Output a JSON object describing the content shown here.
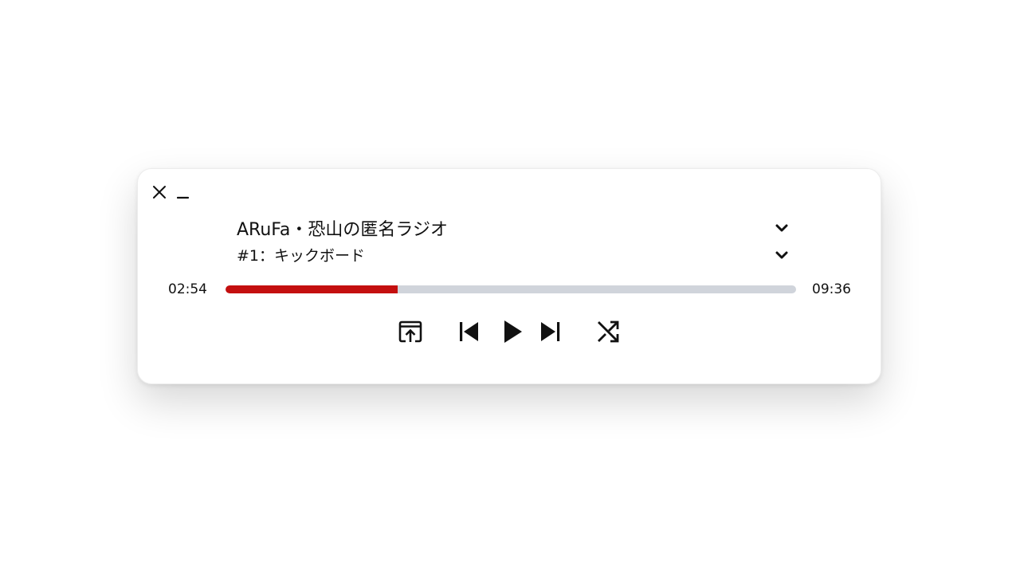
{
  "player": {
    "title": "ARuFa・恐山の匿名ラジオ",
    "episode": "#1：キックボード",
    "time_elapsed": "02:54",
    "time_total": "09:36",
    "progress": 0.302
  },
  "icons": {
    "close": "close-icon",
    "minimize": "minimize-icon",
    "title_dropdown": "chevron-down-icon",
    "episode_dropdown": "chevron-down-icon",
    "open_external": "open-in-window-icon",
    "previous": "skip-previous-icon",
    "play": "play-icon",
    "next": "skip-next-icon",
    "shuffle": "shuffle-icon"
  },
  "colors": {
    "progress_fill": "#c40f0f",
    "progress_track": "#d0d4db",
    "text": "#111111"
  }
}
